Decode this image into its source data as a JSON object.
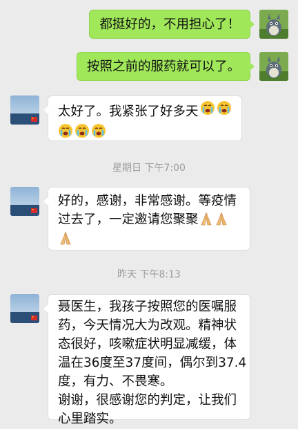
{
  "messages": [
    {
      "text": "都挺好的，不用担心了！"
    },
    {
      "text": "按照之前的服药就可以了。"
    },
    {
      "text": "太好了。我紧张了好多天"
    },
    {
      "lines": [
        "好的，感谢，非常感谢。等疫情",
        "过去了，一定邀请您聚聚"
      ]
    },
    {
      "lines": [
        "聂医生，我孩子按照您的医嘱服",
        "药，今天情况大为改观。精神状",
        "态很好，咳嗽症状明显减缓，体",
        "温在36度至37度间，偶尔到37.4",
        "度，有力、不畏寒。",
        "谢谢，很感谢您的判定，让我们",
        "心里踏实。"
      ]
    }
  ],
  "timestamps": [
    "星期日 下午7:00",
    "昨天 下午8:13"
  ],
  "icons": {
    "crying": "crying-emoji-icon",
    "namaste": "namaste-emoji-icon"
  },
  "colors": {
    "background": "#ebebeb",
    "outgoing_bubble": "#a0e75a",
    "incoming_bubble": "#ffffff",
    "timestamp": "#9a9a9a"
  }
}
